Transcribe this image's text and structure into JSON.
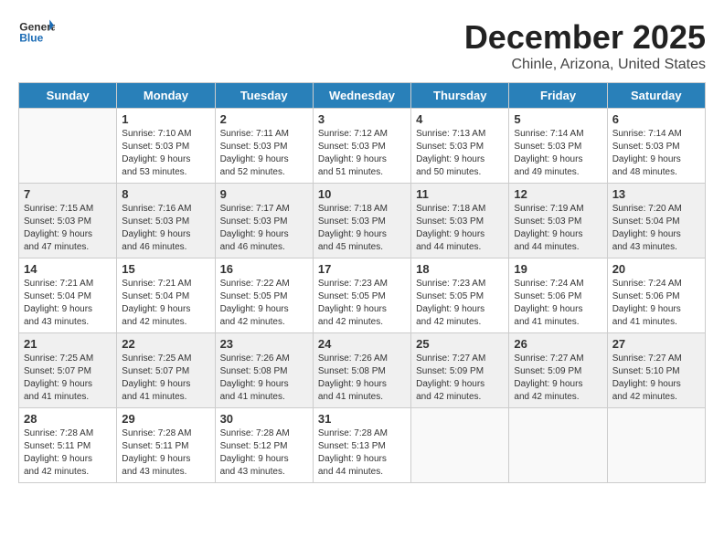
{
  "header": {
    "logo_general": "General",
    "logo_blue": "Blue",
    "month_title": "December 2025",
    "subtitle": "Chinle, Arizona, United States"
  },
  "days_of_week": [
    "Sunday",
    "Monday",
    "Tuesday",
    "Wednesday",
    "Thursday",
    "Friday",
    "Saturday"
  ],
  "weeks": [
    [
      {
        "day": "",
        "info": ""
      },
      {
        "day": "1",
        "info": "Sunrise: 7:10 AM\nSunset: 5:03 PM\nDaylight: 9 hours\nand 53 minutes."
      },
      {
        "day": "2",
        "info": "Sunrise: 7:11 AM\nSunset: 5:03 PM\nDaylight: 9 hours\nand 52 minutes."
      },
      {
        "day": "3",
        "info": "Sunrise: 7:12 AM\nSunset: 5:03 PM\nDaylight: 9 hours\nand 51 minutes."
      },
      {
        "day": "4",
        "info": "Sunrise: 7:13 AM\nSunset: 5:03 PM\nDaylight: 9 hours\nand 50 minutes."
      },
      {
        "day": "5",
        "info": "Sunrise: 7:14 AM\nSunset: 5:03 PM\nDaylight: 9 hours\nand 49 minutes."
      },
      {
        "day": "6",
        "info": "Sunrise: 7:14 AM\nSunset: 5:03 PM\nDaylight: 9 hours\nand 48 minutes."
      }
    ],
    [
      {
        "day": "7",
        "info": "Sunrise: 7:15 AM\nSunset: 5:03 PM\nDaylight: 9 hours\nand 47 minutes."
      },
      {
        "day": "8",
        "info": "Sunrise: 7:16 AM\nSunset: 5:03 PM\nDaylight: 9 hours\nand 46 minutes."
      },
      {
        "day": "9",
        "info": "Sunrise: 7:17 AM\nSunset: 5:03 PM\nDaylight: 9 hours\nand 46 minutes."
      },
      {
        "day": "10",
        "info": "Sunrise: 7:18 AM\nSunset: 5:03 PM\nDaylight: 9 hours\nand 45 minutes."
      },
      {
        "day": "11",
        "info": "Sunrise: 7:18 AM\nSunset: 5:03 PM\nDaylight: 9 hours\nand 44 minutes."
      },
      {
        "day": "12",
        "info": "Sunrise: 7:19 AM\nSunset: 5:03 PM\nDaylight: 9 hours\nand 44 minutes."
      },
      {
        "day": "13",
        "info": "Sunrise: 7:20 AM\nSunset: 5:04 PM\nDaylight: 9 hours\nand 43 minutes."
      }
    ],
    [
      {
        "day": "14",
        "info": "Sunrise: 7:21 AM\nSunset: 5:04 PM\nDaylight: 9 hours\nand 43 minutes."
      },
      {
        "day": "15",
        "info": "Sunrise: 7:21 AM\nSunset: 5:04 PM\nDaylight: 9 hours\nand 42 minutes."
      },
      {
        "day": "16",
        "info": "Sunrise: 7:22 AM\nSunset: 5:05 PM\nDaylight: 9 hours\nand 42 minutes."
      },
      {
        "day": "17",
        "info": "Sunrise: 7:23 AM\nSunset: 5:05 PM\nDaylight: 9 hours\nand 42 minutes."
      },
      {
        "day": "18",
        "info": "Sunrise: 7:23 AM\nSunset: 5:05 PM\nDaylight: 9 hours\nand 42 minutes."
      },
      {
        "day": "19",
        "info": "Sunrise: 7:24 AM\nSunset: 5:06 PM\nDaylight: 9 hours\nand 41 minutes."
      },
      {
        "day": "20",
        "info": "Sunrise: 7:24 AM\nSunset: 5:06 PM\nDaylight: 9 hours\nand 41 minutes."
      }
    ],
    [
      {
        "day": "21",
        "info": "Sunrise: 7:25 AM\nSunset: 5:07 PM\nDaylight: 9 hours\nand 41 minutes."
      },
      {
        "day": "22",
        "info": "Sunrise: 7:25 AM\nSunset: 5:07 PM\nDaylight: 9 hours\nand 41 minutes."
      },
      {
        "day": "23",
        "info": "Sunrise: 7:26 AM\nSunset: 5:08 PM\nDaylight: 9 hours\nand 41 minutes."
      },
      {
        "day": "24",
        "info": "Sunrise: 7:26 AM\nSunset: 5:08 PM\nDaylight: 9 hours\nand 41 minutes."
      },
      {
        "day": "25",
        "info": "Sunrise: 7:27 AM\nSunset: 5:09 PM\nDaylight: 9 hours\nand 42 minutes."
      },
      {
        "day": "26",
        "info": "Sunrise: 7:27 AM\nSunset: 5:09 PM\nDaylight: 9 hours\nand 42 minutes."
      },
      {
        "day": "27",
        "info": "Sunrise: 7:27 AM\nSunset: 5:10 PM\nDaylight: 9 hours\nand 42 minutes."
      }
    ],
    [
      {
        "day": "28",
        "info": "Sunrise: 7:28 AM\nSunset: 5:11 PM\nDaylight: 9 hours\nand 42 minutes."
      },
      {
        "day": "29",
        "info": "Sunrise: 7:28 AM\nSunset: 5:11 PM\nDaylight: 9 hours\nand 43 minutes."
      },
      {
        "day": "30",
        "info": "Sunrise: 7:28 AM\nSunset: 5:12 PM\nDaylight: 9 hours\nand 43 minutes."
      },
      {
        "day": "31",
        "info": "Sunrise: 7:28 AM\nSunset: 5:13 PM\nDaylight: 9 hours\nand 44 minutes."
      },
      {
        "day": "",
        "info": ""
      },
      {
        "day": "",
        "info": ""
      },
      {
        "day": "",
        "info": ""
      }
    ]
  ]
}
